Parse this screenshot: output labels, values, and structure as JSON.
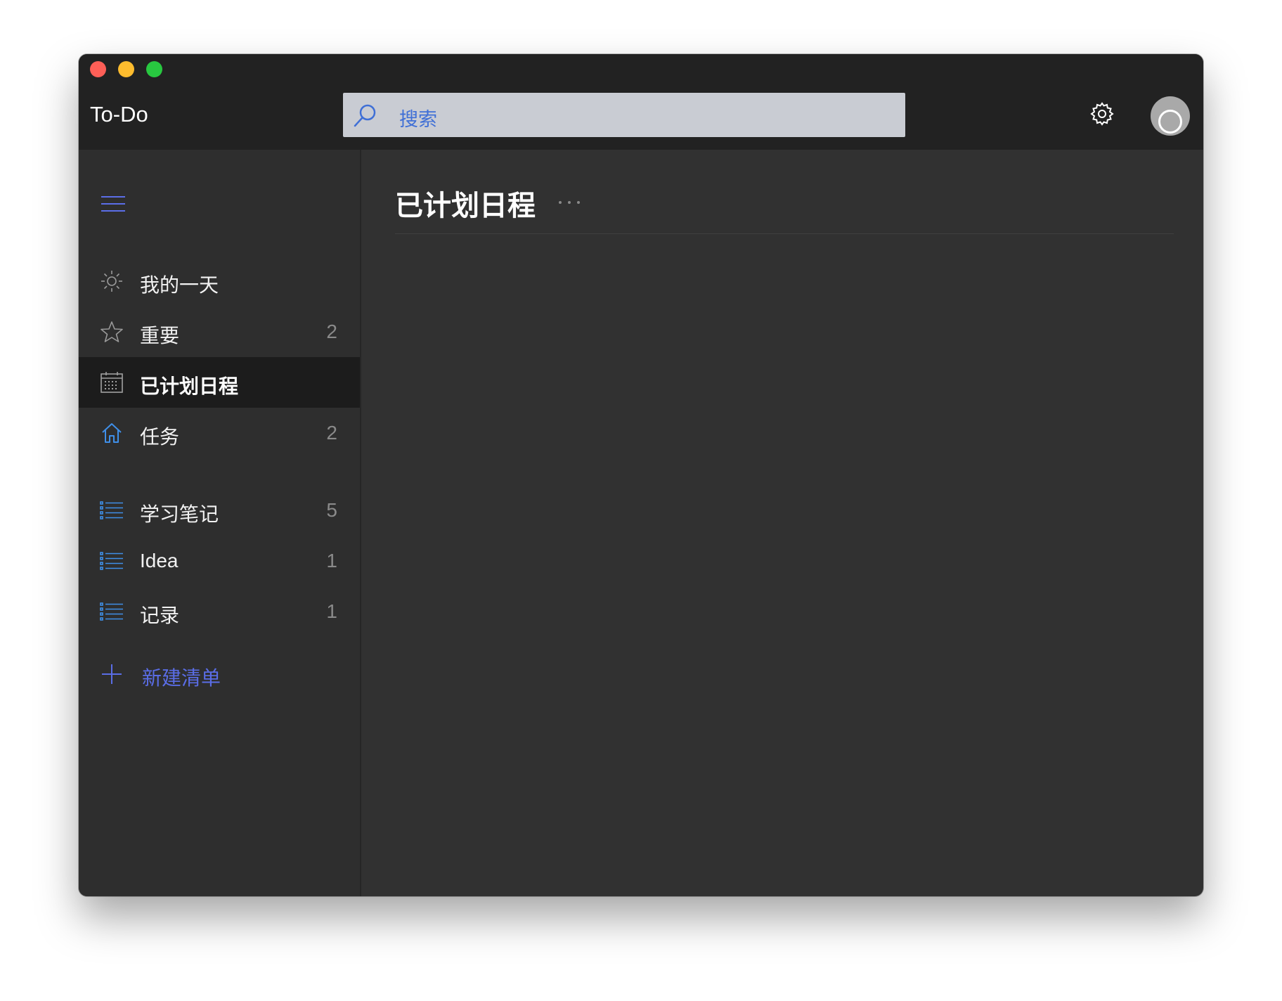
{
  "app": {
    "title": "To-Do"
  },
  "search": {
    "placeholder": "搜索"
  },
  "sidebar": {
    "items": [
      {
        "label": "我的一天",
        "count": "",
        "icon": "sun-icon"
      },
      {
        "label": "重要",
        "count": "2",
        "icon": "star-icon"
      },
      {
        "label": "已计划日程",
        "count": "",
        "icon": "calendar-icon",
        "active": true
      },
      {
        "label": "任务",
        "count": "2",
        "icon": "home-icon"
      }
    ],
    "lists": [
      {
        "label": "学习笔记",
        "count": "5",
        "icon": "list-icon"
      },
      {
        "label": "Idea",
        "count": "1",
        "icon": "list-icon"
      },
      {
        "label": "记录",
        "count": "1",
        "icon": "list-icon"
      }
    ],
    "new_list_label": "新建清单"
  },
  "main": {
    "title": "已计划日程"
  },
  "colors": {
    "accent": "#5a6de6",
    "search_text": "#3f6fd6",
    "titlebar": "#222222",
    "sidebar": "#2e2e2e",
    "content": "#313131",
    "active_item": "#1c1c1c"
  }
}
